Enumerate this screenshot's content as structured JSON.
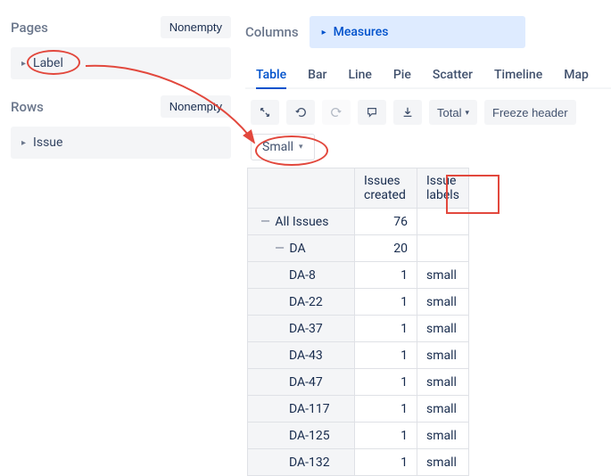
{
  "pages": {
    "title": "Pages",
    "nonempty": "Nonempty",
    "item": "Label"
  },
  "rows": {
    "title": "Rows",
    "nonempty": "Nonempty",
    "item": "Issue"
  },
  "columns": {
    "title": "Columns",
    "measures": "Measures"
  },
  "tabs": [
    "Table",
    "Bar",
    "Line",
    "Pie",
    "Scatter",
    "Timeline",
    "Map"
  ],
  "toolbar": {
    "total": "Total",
    "freeze": "Freeze header"
  },
  "filter": {
    "label": "Small"
  },
  "table": {
    "headers": [
      "Issues created",
      "Issue labels"
    ],
    "rows": [
      {
        "label": "All Issues",
        "indent": 1,
        "tree": "—",
        "created": "76",
        "labels": ""
      },
      {
        "label": "DA",
        "indent": 2,
        "tree": "—",
        "created": "20",
        "labels": ""
      },
      {
        "label": "DA-8",
        "indent": 3,
        "tree": "",
        "created": "1",
        "labels": "small"
      },
      {
        "label": "DA-22",
        "indent": 3,
        "tree": "",
        "created": "1",
        "labels": "small"
      },
      {
        "label": "DA-37",
        "indent": 3,
        "tree": "",
        "created": "1",
        "labels": "small"
      },
      {
        "label": "DA-43",
        "indent": 3,
        "tree": "",
        "created": "1",
        "labels": "small"
      },
      {
        "label": "DA-47",
        "indent": 3,
        "tree": "",
        "created": "1",
        "labels": "small"
      },
      {
        "label": "DA-117",
        "indent": 3,
        "tree": "",
        "created": "1",
        "labels": "small"
      },
      {
        "label": "DA-125",
        "indent": 3,
        "tree": "",
        "created": "1",
        "labels": "small"
      },
      {
        "label": "DA-132",
        "indent": 3,
        "tree": "",
        "created": "1",
        "labels": "small"
      }
    ]
  }
}
